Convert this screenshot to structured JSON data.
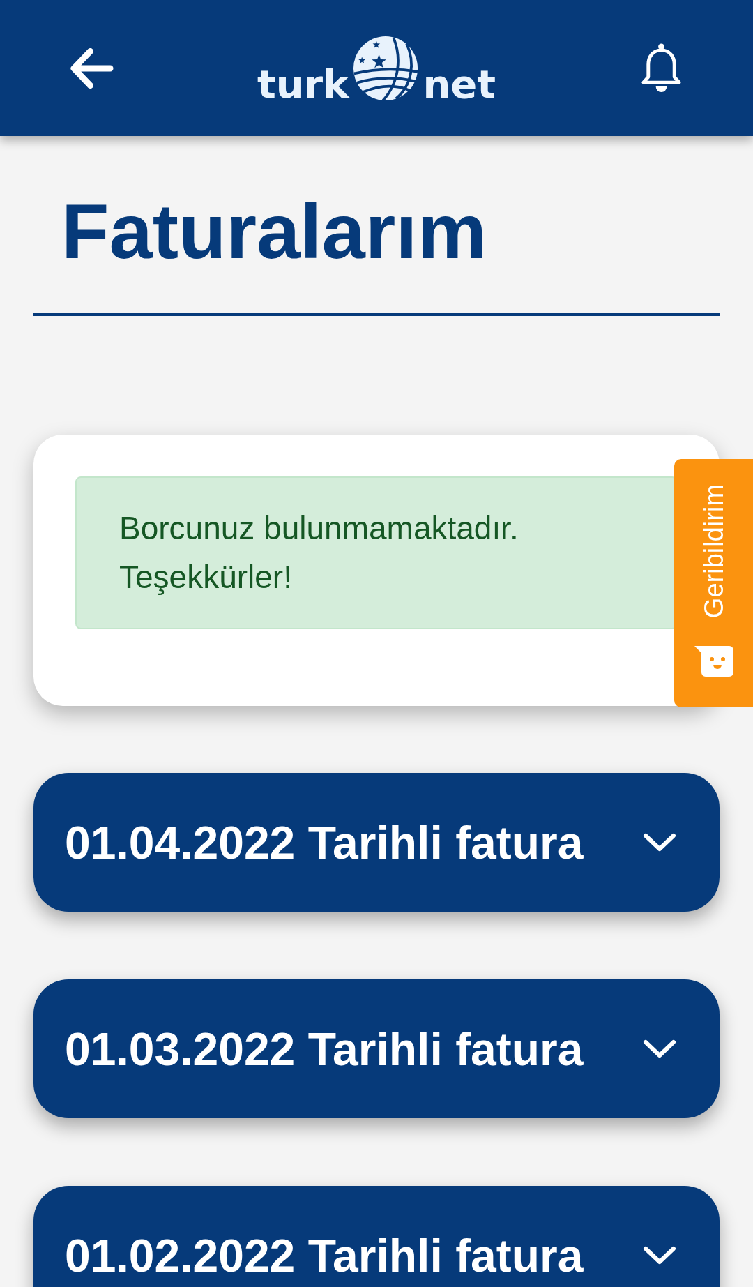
{
  "header": {
    "logo": {
      "text_before": "turk",
      "text_after": "net"
    }
  },
  "page_title": "Faturalarım",
  "notice": {
    "text": "Borcunuz bulunmamaktadır. Teşekkürler!"
  },
  "feedback_tab": {
    "label": "Geribildirim"
  },
  "invoices": [
    {
      "title": "01.04.2022 Tarihli fatura",
      "expanded": false
    },
    {
      "title": "01.03.2022 Tarihli fatura",
      "expanded": false
    },
    {
      "title": "01.02.2022 Tarihli fatura",
      "expanded": false
    }
  ]
}
